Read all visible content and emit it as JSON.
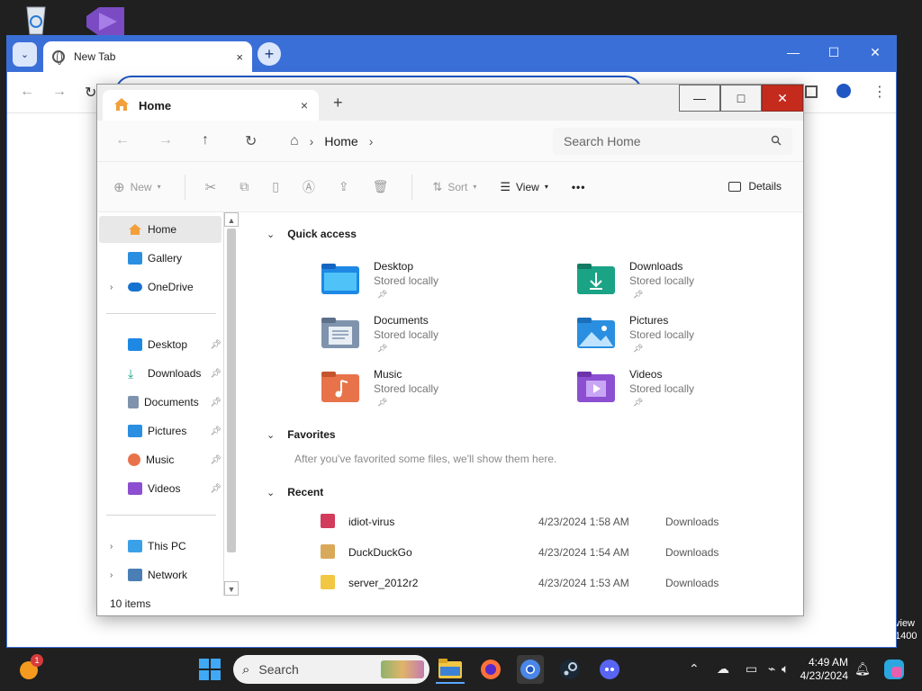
{
  "desktop": {
    "side_text_line1": "view",
    "side_text_line2": "1400"
  },
  "chrome": {
    "tab_title": "New Tab",
    "tab_close": "×",
    "new_tab": "+",
    "win_minimize": "—",
    "win_maximize": "☐",
    "win_close": "✕",
    "tab_search": "⌄",
    "back": "←",
    "forward": "→",
    "reload": "↻",
    "menu": "⋮"
  },
  "explorer": {
    "tab_title": "Home",
    "tab_close": "×",
    "new_tab": "+",
    "win_minimize": "—",
    "win_maximize": "□",
    "win_close": "✕",
    "nav": {
      "back": "←",
      "forward": "→",
      "up": "↑",
      "refresh": "↻"
    },
    "breadcrumb": {
      "home_icon": "⌂",
      "sep1": "›",
      "current": "Home",
      "sep2": "›"
    },
    "search_placeholder": "Search Home",
    "commands": {
      "new": "New",
      "sort": "Sort",
      "view": "View",
      "more": "•••",
      "details": "Details"
    },
    "navpane": {
      "home": "Home",
      "gallery": "Gallery",
      "onedrive": "OneDrive",
      "desktop": "Desktop",
      "downloads": "Downloads",
      "documents": "Documents",
      "pictures": "Pictures",
      "music": "Music",
      "videos": "Videos",
      "this_pc": "This PC",
      "network": "Network"
    },
    "status": "10 items",
    "quick_access": {
      "header": "Quick access",
      "items": [
        {
          "name": "Desktop",
          "sub": "Stored locally",
          "color": "#1e88e5"
        },
        {
          "name": "Downloads",
          "sub": "Stored locally",
          "color": "#1aa385"
        },
        {
          "name": "Documents",
          "sub": "Stored locally",
          "color": "#7f93ad"
        },
        {
          "name": "Pictures",
          "sub": "Stored locally",
          "color": "#2a8fe0"
        },
        {
          "name": "Music",
          "sub": "Stored locally",
          "color": "#e8734a"
        },
        {
          "name": "Videos",
          "sub": "Stored locally",
          "color": "#8c4fd1"
        }
      ]
    },
    "favorites": {
      "header": "Favorites",
      "message": "After you've favorited some files, we'll show them here."
    },
    "recent": {
      "header": "Recent",
      "rows": [
        {
          "name": "idiot-virus",
          "date": "4/23/2024 1:58 AM",
          "location": "Downloads",
          "color": "#d23b5c"
        },
        {
          "name": "DuckDuckGo",
          "date": "4/23/2024 1:54 AM",
          "location": "Downloads",
          "color": "#d9a95a"
        },
        {
          "name": "server_2012r2",
          "date": "4/23/2024 1:53 AM",
          "location": "Downloads",
          "color": "#f2c744"
        }
      ]
    }
  },
  "taskbar": {
    "search_label": "Search",
    "time": "4:49 AM",
    "date": "4/23/2024",
    "notification_badge": "1"
  }
}
